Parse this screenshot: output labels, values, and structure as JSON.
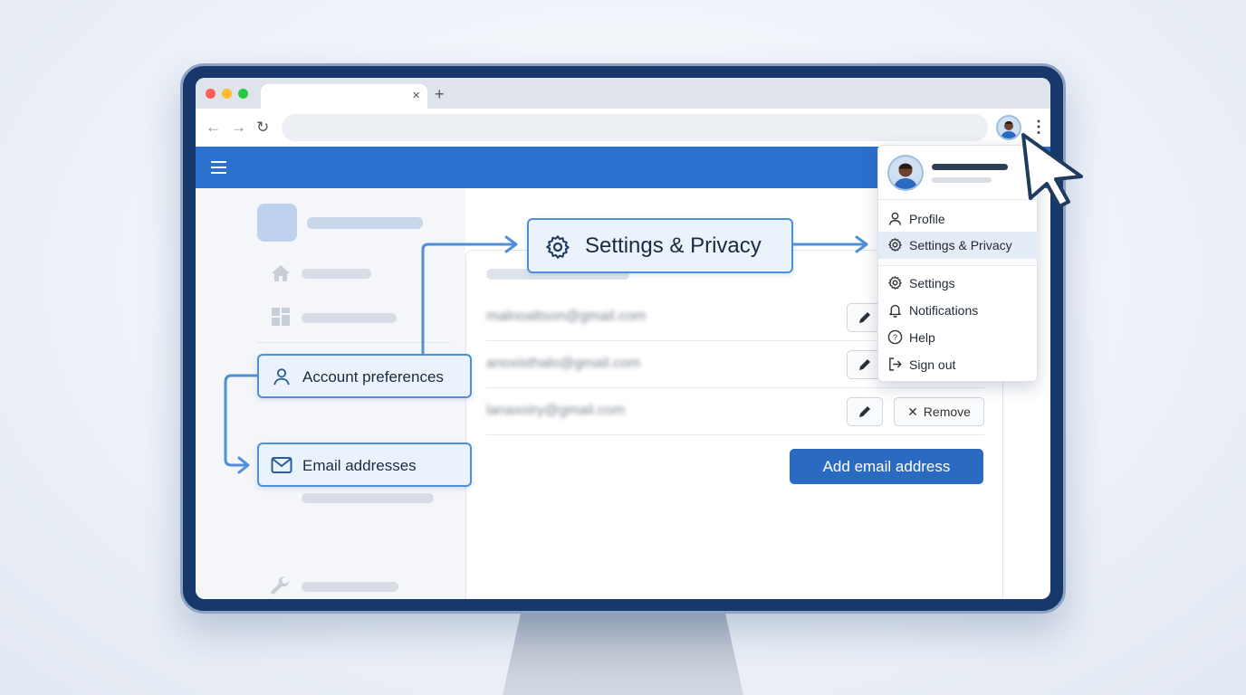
{
  "browser": {
    "tab_close": "×",
    "new_tab": "+",
    "back": "←",
    "forward": "→",
    "reload": "↻",
    "menu": "⋮",
    "traffic_lights": [
      "#ff5f57",
      "#febc2e",
      "#28c840"
    ]
  },
  "app": {
    "accent": "#2b70cc"
  },
  "callouts": {
    "settings_privacy": "Settings & Privacy",
    "account_preferences": "Account preferences",
    "email_addresses": "Email addresses"
  },
  "emails": [
    {
      "address": "malnoattson@gmail.com"
    },
    {
      "address": "anoxisthalo@gmail.com"
    },
    {
      "address": "lanaxoiry@gmail.com",
      "remove_label": "Remove"
    }
  ],
  "add_button": "Add email address",
  "dropdown": {
    "items": [
      {
        "label": "Profile",
        "icon": "user-icon"
      },
      {
        "label": "Settings & Privacy",
        "icon": "gear-icon",
        "active": true
      },
      {
        "label": "Settings",
        "icon": "gear-icon"
      },
      {
        "label": "Notifications",
        "icon": "bell-icon"
      },
      {
        "label": "Help",
        "icon": "help-circle-icon"
      },
      {
        "label": "Sign out",
        "icon": "sign-out-icon"
      }
    ]
  }
}
